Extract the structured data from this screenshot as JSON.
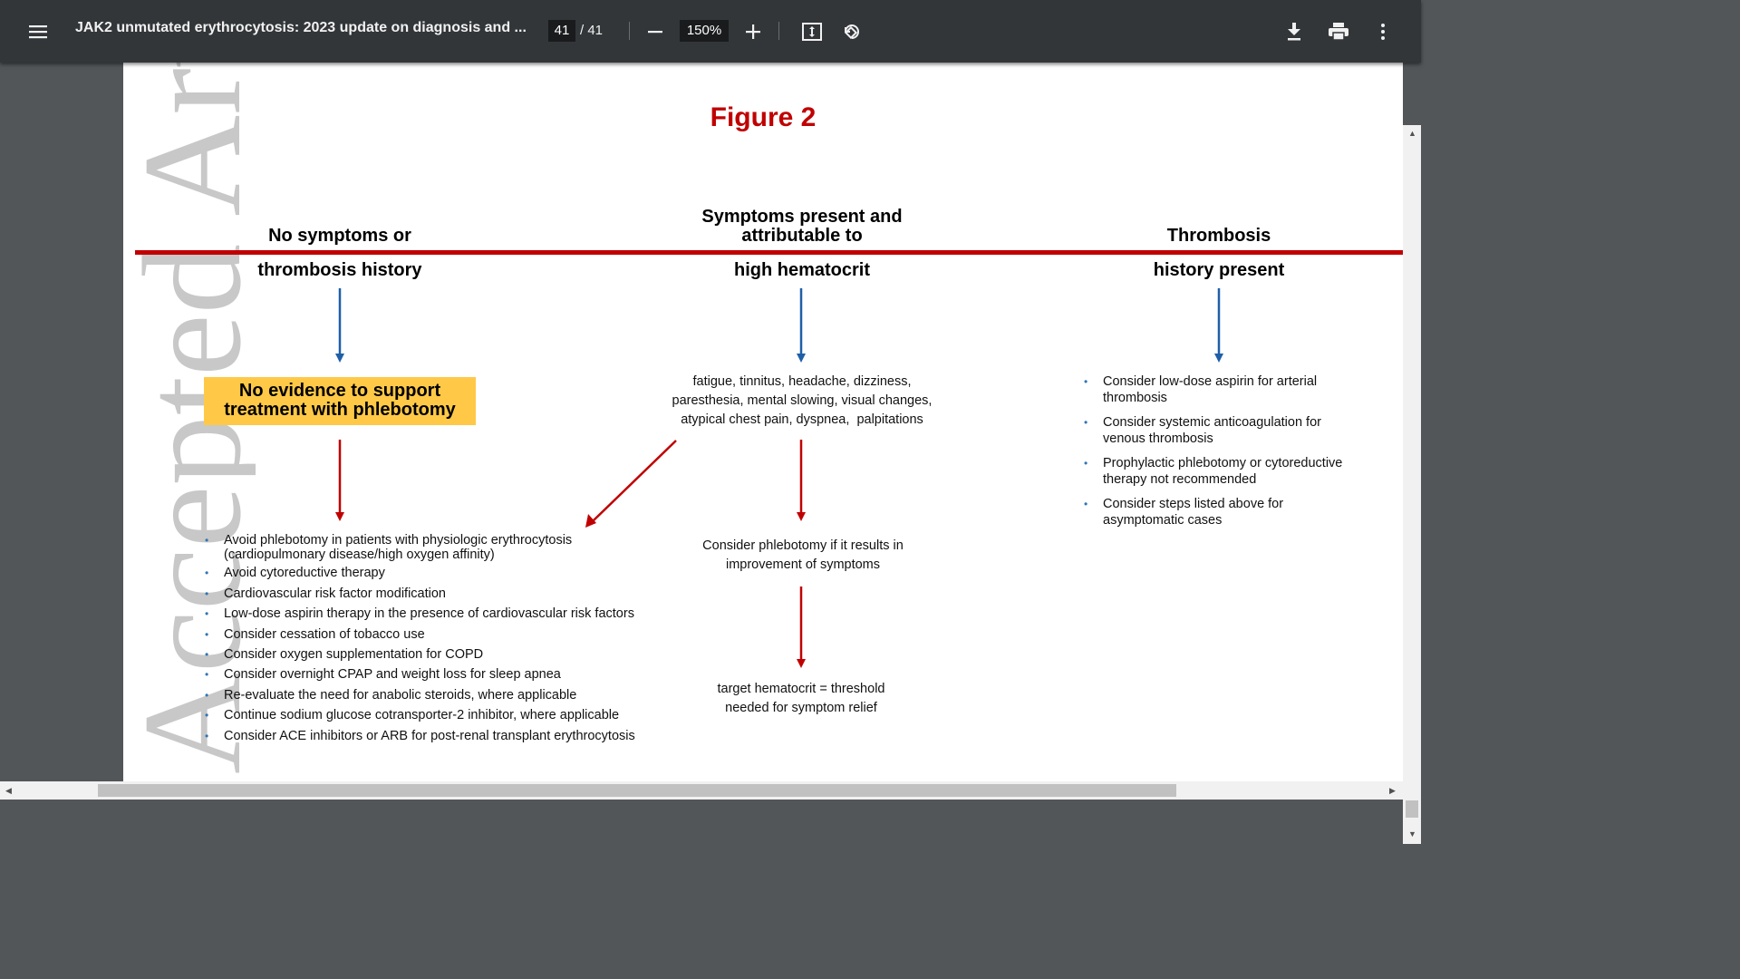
{
  "toolbar": {
    "title": "JAK2 unmutated erythrocytosis: 2023 update on diagnosis and ...",
    "page_current": "41",
    "page_total": "/ 41",
    "zoom": "150%",
    "icons": [
      "menu-icon",
      "zoom-out-icon",
      "zoom-in-icon",
      "fit-page-icon",
      "rotate-icon",
      "download-icon",
      "print-icon",
      "more-icon"
    ]
  },
  "document": {
    "watermark": "Accepted Article",
    "figure_title": "Figure 2",
    "col1": {
      "header_top": "No symptoms or",
      "header_bottom": "thrombosis history",
      "box_line1": "No evidence to support",
      "box_line2": "treatment with phlebotomy",
      "box_color": "#ffc947",
      "items": [
        "Avoid phlebotomy in patients with physiologic erythrocytosis",
        "(cardiopulmonary disease/high oxygen affinity)",
        "Avoid cytoreductive therapy",
        "Cardiovascular risk factor modification",
        "Low-dose aspirin therapy in the presence of cardiovascular risk factors",
        "Consider cessation of tobacco use",
        "Consider oxygen supplementation for COPD",
        "Consider overnight CPAP and weight loss for sleep apnea",
        "Re-evaluate the need for anabolic steroids, where applicable",
        "Continue sodium glucose cotransporter-2 inhibitor, where applicable",
        "Consider ACE inhibitors or ARB for post-renal transplant erythrocytosis"
      ]
    },
    "col2": {
      "header_line1": "Symptoms present and",
      "header_line2": "attributable to",
      "header_bottom": "high hematocrit",
      "symptoms_line1": "fatigue, tinnitus, headache, dizziness,",
      "symptoms_line2": "paresthesia, mental slowing, visual changes,",
      "symptoms_line3": "atypical chest pain, dyspnea,  palpitations",
      "phleb_line1": "Consider phlebotomy if it results in",
      "phleb_line2": "improvement of symptoms",
      "target_line1": "target hematocrit = threshold",
      "target_line2": "needed for symptom relief"
    },
    "col3": {
      "header_top": "Thrombosis",
      "header_bottom": "history present",
      "items": [
        {
          "line1": "Consider low-dose aspirin for arterial",
          "line2": "thrombosis"
        },
        {
          "line1": "Consider systemic anticoagulation for",
          "line2": "venous thrombosis"
        },
        {
          "line1": "Prophylactic phlebotomy or cytoreductive",
          "line2": "therapy not recommended"
        },
        {
          "line1": "Consider steps listed above for",
          "line2": "asymptomatic cases"
        }
      ]
    },
    "colors": {
      "accent_red": "#c00000",
      "arrow_blue": "#1f5fa8",
      "bullet_blue": "#2e75b6"
    }
  }
}
